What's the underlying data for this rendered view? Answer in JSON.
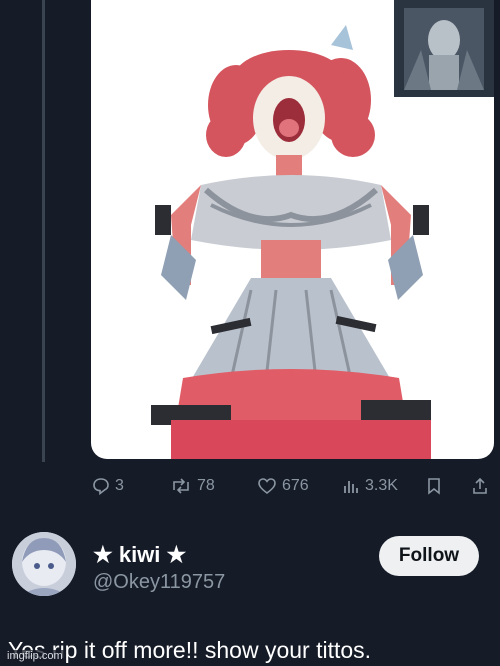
{
  "post": {
    "image_alt": "Anime-style drawing of a girl with red twin-drill hair tearing at her shirt",
    "actions": {
      "replies": "3",
      "reposts": "78",
      "likes": "676",
      "views": "3.3K"
    }
  },
  "reply": {
    "name": "★ kiwi ★",
    "handle": "@Okey119757",
    "follow_label": "Follow",
    "text": "Yes rip it off more!! show your tittos."
  },
  "watermark": "imgflip.com",
  "colors": {
    "background": "#151b27",
    "muted_text": "#8b96a3",
    "follow_bg": "#eef0f2"
  },
  "icons": [
    "reply-icon",
    "repost-icon",
    "like-icon",
    "views-icon",
    "bookmark-icon",
    "share-icon"
  ]
}
